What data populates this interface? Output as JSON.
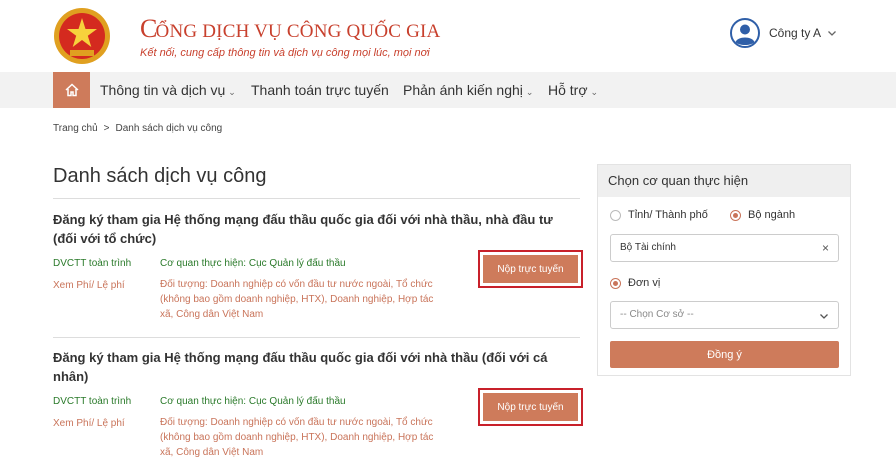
{
  "header": {
    "title_initial": "C",
    "title_rest": "ỔNG DỊCH VỤ CÔNG QUỐC GIA",
    "subtitle": "Kết nối, cung cấp thông tin và dịch vụ công mọi lúc, mọi nơi",
    "emblem_icon": "national-emblem-icon",
    "user_name": "Công ty A"
  },
  "nav": {
    "home_icon": "home-icon",
    "items": [
      {
        "label": "Thông tin và dịch vụ",
        "has_dropdown": true
      },
      {
        "label": "Thanh toán trực tuyến",
        "has_dropdown": false
      },
      {
        "label": "Phản ánh kiến nghị",
        "has_dropdown": true
      },
      {
        "label": "Hỗ trợ",
        "has_dropdown": true
      }
    ]
  },
  "breadcrumb": {
    "home": "Trang chủ",
    "separator": ">",
    "current": "Danh sách dịch vụ công"
  },
  "main": {
    "title": "Danh sách dịch vụ công",
    "services": [
      {
        "title_line1": "Đăng ký tham gia Hệ thống mạng đấu thầu quốc gia đối với nhà thầu, nhà đầu tư",
        "title_line2": "(đối với tổ chức)",
        "type": "DVCTT toàn trình",
        "fee": "Xem Phí/ Lệ phí",
        "agency": "Cơ quan thực hiện: Cục Quản lý đấu thầu",
        "target_line1": "Đối tượng: Doanh nghiệp có vốn đầu tư nước ngoài, Tổ chức",
        "target_line2": "(không bao gồm doanh nghiệp, HTX), Doanh nghiệp, Hợp tác",
        "target_line3": "xã, Công dân Việt Nam",
        "button": "Nộp trực tuyến"
      },
      {
        "title_line1": "Đăng ký tham gia Hệ thống mạng đấu thầu quốc gia đối với nhà thầu (đối với cá",
        "title_line2": "nhân)",
        "type": "DVCTT toàn trình",
        "fee": "Xem Phí/ Lệ phí",
        "agency": "Cơ quan thực hiện: Cục Quản lý đấu thầu",
        "target_line1": "Đối tượng: Doanh nghiệp có vốn đầu tư nước ngoài, Tổ chức",
        "target_line2": "(không bao gồm doanh nghiệp, HTX), Doanh nghiệp, Hợp tác",
        "target_line3": "xã, Công dân Việt Nam",
        "button": "Nộp trực tuyến"
      }
    ]
  },
  "sidebar": {
    "title": "Chọn cơ quan thực hiện",
    "radio_province": "Tỉnh/ Thành phố",
    "radio_ministry": "Bộ ngành",
    "ministry_selected": true,
    "ministry_value": "Bộ Tài chính",
    "clear_symbol": "×",
    "radio_unit": "Đơn vị",
    "unit_selected": true,
    "base_placeholder": "-- Chọn Cơ sở --",
    "agree_button": "Đồng ý"
  },
  "colors": {
    "brand_red": "#c8402d",
    "accent": "#ce7b5b",
    "highlight_border": "#c8202a",
    "green_text": "#2a7a2a"
  }
}
